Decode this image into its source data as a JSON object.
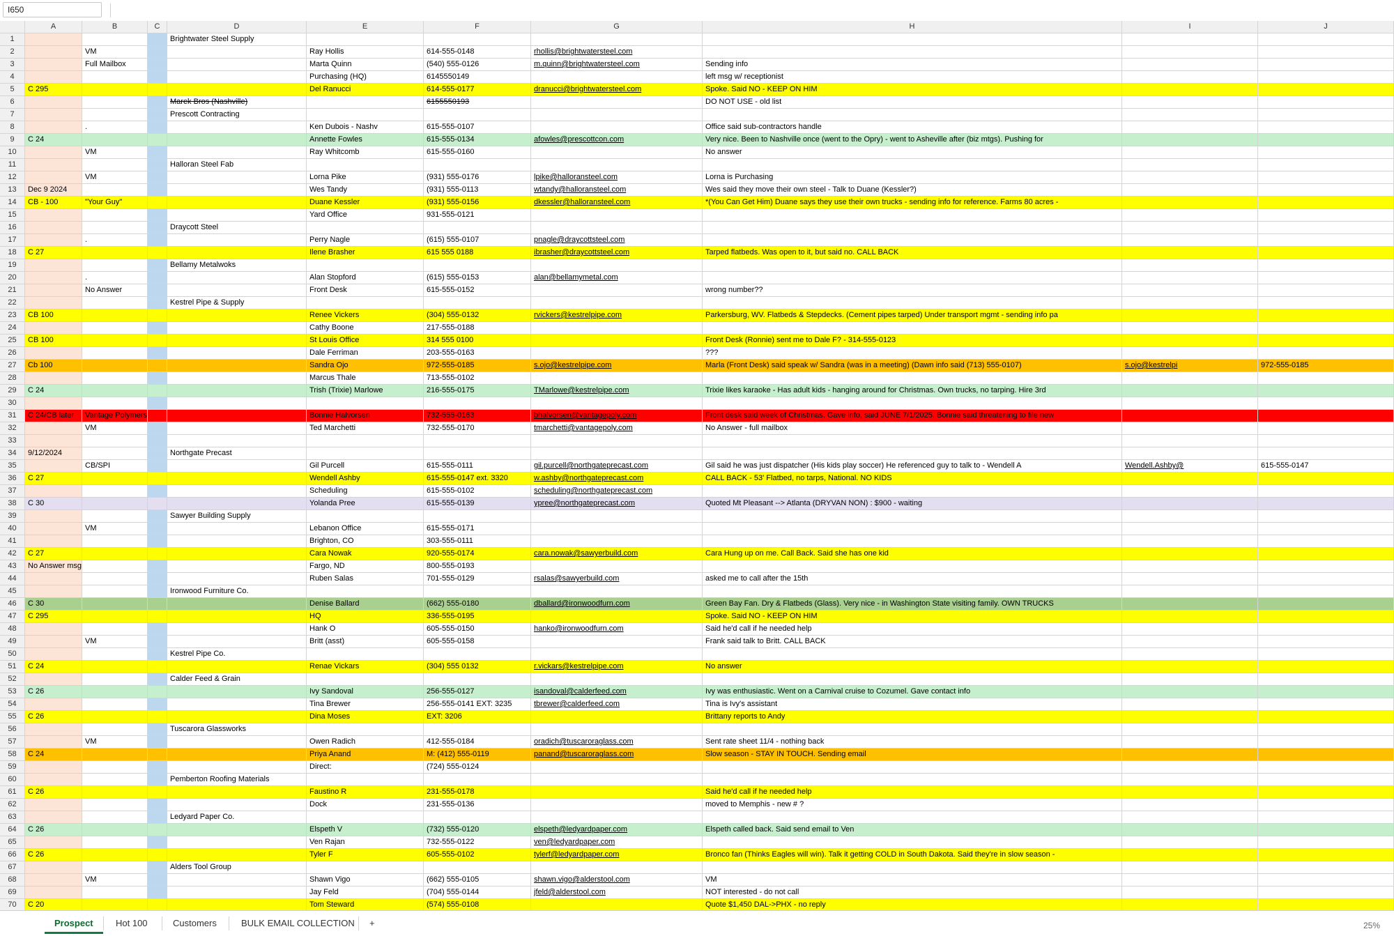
{
  "name_box": "I650",
  "columns": [
    "A",
    "B",
    "C",
    "D",
    "E",
    "F",
    "G",
    "H",
    "I",
    "J"
  ],
  "colors": {
    "yellow": "#ffff00",
    "green": "#c6efce",
    "orange": "#ffc000",
    "red": "#ff0000",
    "lavender": "#e4dff0",
    "darkgreen": "#a9d08e",
    "colA": "#fce4d6",
    "colC": "#bdd7ee"
  },
  "rows": [
    {
      "n": "1",
      "c": "",
      "a": "",
      "b": "",
      "d": "Brightwater Steel Supply",
      "e": "",
      "f": "",
      "g": "",
      "h": "",
      "i": "",
      "j": ""
    },
    {
      "n": "2",
      "c": "",
      "a": "",
      "b": "VM",
      "d": "",
      "e": "Ray Hollis",
      "f": "614-555-0148",
      "g": "rhollis@brightwatersteel.com",
      "h": "",
      "i": "",
      "j": ""
    },
    {
      "n": "3",
      "c": "",
      "a": "",
      "b": "Full Mailbox",
      "d": "",
      "e": "Marta Quinn",
      "f": "(540) 555-0126",
      "g": "m.quinn@brightwatersteel.com",
      "h": "Sending info",
      "i": "",
      "j": ""
    },
    {
      "n": "4",
      "c": "",
      "a": "",
      "b": "",
      "d": "",
      "e": "Purchasing (HQ)",
      "f": "6145550149",
      "g": "",
      "h": "left msg w/ receptionist",
      "i": "",
      "j": ""
    },
    {
      "n": "5",
      "c": "yellow",
      "a": "C 295",
      "b": "",
      "d": "",
      "e": "Del Ranucci",
      "f": "614-555-0177",
      "g": "dranucci@brightwatersteel.com",
      "h": "Spoke. Said NO - KEEP ON HIM",
      "i": "",
      "j": ""
    },
    {
      "n": "6",
      "c": "",
      "a": "",
      "b": "",
      "d": "Marek Bros (Nashville)",
      "e": "",
      "f": "6155550193",
      "g": "",
      "h": "DO NOT USE - old list",
      "i": "",
      "j": "",
      "strike": true
    },
    {
      "n": "7",
      "c": "",
      "a": "",
      "b": "",
      "d": "Prescott Contracting",
      "e": "",
      "f": "",
      "g": "",
      "h": "",
      "i": "",
      "j": ""
    },
    {
      "n": "8",
      "c": "",
      "a": "",
      "b": ".",
      "d": "",
      "e": "Ken Dubois - Nashv",
      "f": "615-555-0107",
      "g": "",
      "h": "Office said sub-contractors handle",
      "i": "",
      "j": ""
    },
    {
      "n": "9",
      "c": "green",
      "a": "C 24",
      "b": "",
      "d": "",
      "e": "Annette Fowles",
      "f": "615-555-0134",
      "g": "afowles@prescottcon.com",
      "h": "Very nice. Been to Nashville once (went to the Opry) - went to Asheville after (biz mtgs). Pushing for",
      "i": "",
      "j": ""
    },
    {
      "n": "10",
      "c": "",
      "a": "",
      "b": "VM",
      "d": "",
      "e": "Ray Whitcomb",
      "f": "615-555-0160",
      "g": "",
      "h": "No answer",
      "i": "",
      "j": ""
    },
    {
      "n": "11",
      "c": "",
      "a": "",
      "b": "",
      "d": "Halloran Steel Fab",
      "e": "",
      "f": "",
      "g": "",
      "h": "",
      "i": "",
      "j": ""
    },
    {
      "n": "12",
      "c": "",
      "a": "",
      "b": "VM",
      "d": "",
      "e": "Lorna Pike",
      "f": "(931) 555-0176",
      "g": "lpike@halloransteel.com",
      "h": "Lorna is Purchasing",
      "i": "",
      "j": ""
    },
    {
      "n": "13",
      "c": "",
      "a": "Dec 9 2024",
      "b": "",
      "d": "",
      "e": "Wes Tandy",
      "f": "(931) 555-0113",
      "g": "wtandy@halloransteel.com",
      "h": "Wes said they move their own steel - Talk to Duane (Kessler?)",
      "i": "",
      "j": ""
    },
    {
      "n": "14",
      "c": "yellow",
      "a": "CB - 100",
      "b": "\"Your Guy\"",
      "d": "",
      "e": "Duane Kessler",
      "f": "(931) 555-0156",
      "g": "dkessler@halloransteel.com",
      "h": "*(You Can Get Him) Duane says they use their own trucks - sending info for reference. Farms 80 acres -",
      "i": "",
      "j": ""
    },
    {
      "n": "15",
      "c": "",
      "a": "",
      "b": "",
      "d": "",
      "e": "Yard Office",
      "f": "931-555-0121",
      "g": "",
      "h": "",
      "i": "",
      "j": ""
    },
    {
      "n": "16",
      "c": "",
      "a": "",
      "b": "",
      "d": "Draycott Steel",
      "e": "",
      "f": "",
      "g": "",
      "h": "",
      "i": "",
      "j": ""
    },
    {
      "n": "17",
      "c": "",
      "a": "",
      "b": ".",
      "d": "",
      "e": "Perry Nagle",
      "f": "(615) 555-0107",
      "g": "pnagle@draycottsteel.com",
      "h": "",
      "i": "",
      "j": ""
    },
    {
      "n": "18",
      "c": "yellow",
      "a": "C 27",
      "b": "",
      "d": "",
      "e": "Ilene Brasher",
      "f": "615 555 0188",
      "g": "ibrasher@draycottsteel.com",
      "h": "Tarped flatbeds. Was open to it, but said no. CALL BACK",
      "i": "",
      "j": ""
    },
    {
      "n": "19",
      "c": "",
      "a": "",
      "b": "",
      "d": "Bellamy Metalwoks",
      "e": "",
      "f": "",
      "g": "",
      "h": "",
      "i": "",
      "j": ""
    },
    {
      "n": "20",
      "c": "",
      "a": "",
      "b": ".",
      "d": "",
      "e": "Alan Stopford",
      "f": "(615) 555-0153",
      "g": "alan@bellamymetal.com",
      "h": "",
      "i": "",
      "j": ""
    },
    {
      "n": "21",
      "c": "",
      "a": "",
      "b": "No Answer",
      "d": "",
      "e": "Front Desk",
      "f": "615-555-0152",
      "g": "",
      "h": "wrong number??",
      "i": "",
      "j": ""
    },
    {
      "n": "22",
      "c": "",
      "a": "",
      "b": "",
      "d": "Kestrel Pipe & Supply",
      "e": "",
      "f": "",
      "g": "",
      "h": "",
      "i": "",
      "j": ""
    },
    {
      "n": "23",
      "c": "yellow",
      "a": "CB 100",
      "b": "",
      "d": "",
      "e": "Renee Vickers",
      "f": "(304) 555-0132",
      "g": "rvickers@kestrelpipe.com",
      "h": "Parkersburg, WV. Flatbeds & Stepdecks. (Cement pipes tarped) Under transport mgmt - sending info pa",
      "i": "",
      "j": ""
    },
    {
      "n": "24",
      "c": "",
      "a": "",
      "b": "",
      "d": "",
      "e": "Cathy Boone",
      "f": "217-555-0188",
      "g": "",
      "h": "",
      "i": "",
      "j": ""
    },
    {
      "n": "25",
      "c": "yellow",
      "a": "CB 100",
      "b": "",
      "d": "",
      "e": "St Louis Office",
      "f": "314 555 0100",
      "g": "",
      "h": "Front Desk (Ronnie) sent me to Dale F? - 314-555-0123",
      "i": "",
      "j": ""
    },
    {
      "n": "26",
      "c": "",
      "a": "",
      "b": "",
      "d": "",
      "e": "Dale Ferriman",
      "f": "203-555-0163",
      "g": "",
      "h": "???",
      "i": "",
      "j": ""
    },
    {
      "n": "27",
      "c": "orange",
      "a": "Cb 100",
      "b": "",
      "d": "",
      "e": "Sandra Ojo",
      "f": "972-555-0185",
      "g": "s.ojo@kestrelpipe.com",
      "h": "Marla (Front Desk) said speak w/ Sandra (was in a meeting) (Dawn info said (713) 555-0107)",
      "i": "s.ojo@kestrelpi",
      "j": "972-555-0185"
    },
    {
      "n": "28",
      "c": "",
      "a": "",
      "b": "",
      "d": "",
      "e": "Marcus Thale",
      "f": "713-555-0102",
      "g": "",
      "h": "",
      "i": "",
      "j": ""
    },
    {
      "n": "29",
      "c": "green",
      "a": "C 24",
      "b": "",
      "d": "",
      "e": "Trish (Trixie) Marlowe",
      "f": "216-555-0175",
      "g": "TMarlowe@kestrelpipe.com",
      "h": "Trixie likes karaoke - Has adult kids - hanging around for Christmas. Own trucks, no tarping. Hire 3rd",
      "i": "",
      "j": ""
    },
    {
      "n": "30",
      "c": "",
      "a": "",
      "b": "",
      "d": "",
      "e": "",
      "f": "",
      "g": "",
      "h": "",
      "i": "",
      "j": ""
    },
    {
      "n": "31",
      "c": "red",
      "a": "C 24/CB later",
      "b": "Vantage Polymers",
      "d": "",
      "e": "Bonnie Halvorsen",
      "f": "732-555-0163",
      "g": "bhalvorsen@vantagepoly.com",
      "h": "Front desk said week of Christmas. Gave info, said JUNE 7/1/2025. Bonnie said threatening to file new",
      "i": "",
      "j": ""
    },
    {
      "n": "32",
      "c": "",
      "a": "",
      "b": "VM",
      "d": "",
      "e": "Ted Marchetti",
      "f": "732-555-0170",
      "g": "tmarchetti@vantagepoly.com",
      "h": "No Answer - full mailbox",
      "i": "",
      "j": ""
    },
    {
      "n": "33",
      "c": "",
      "a": "",
      "b": "",
      "d": "",
      "e": "",
      "f": "",
      "g": "",
      "h": "",
      "i": "",
      "j": ""
    },
    {
      "n": "34",
      "c": "",
      "a": "9/12/2024",
      "b": "",
      "d": "Northgate Precast",
      "e": "",
      "f": "",
      "g": "",
      "h": "",
      "i": "",
      "j": ""
    },
    {
      "n": "35",
      "c": "",
      "a": "",
      "b": "CB/SPI",
      "d": "",
      "e": "Gil Purcell",
      "f": "615-555-0111",
      "g": "gil.purcell@northgateprecast.com",
      "h": "Gil said he was just dispatcher (His kids play soccer) He referenced guy to talk to - Wendell A",
      "i": "Wendell.Ashby@",
      "j": "615-555-0147"
    },
    {
      "n": "36",
      "c": "yellow",
      "a": "C 27",
      "b": "",
      "d": "",
      "e": "Wendell Ashby",
      "f": "615-555-0147 ext. 3320",
      "g": "w.ashby@northgateprecast.com",
      "h": "CALL BACK - 53' Flatbed, no tarps, National. NO KIDS",
      "i": "",
      "j": ""
    },
    {
      "n": "37",
      "c": "",
      "a": "",
      "b": "",
      "d": "",
      "e": "Scheduling",
      "f": "615-555-0102",
      "g": "scheduling@northgateprecast.com",
      "h": "",
      "i": "",
      "j": ""
    },
    {
      "n": "38",
      "c": "lavender",
      "a": "C 30",
      "b": "",
      "d": "",
      "e": "Yolanda Pree",
      "f": "615-555-0139",
      "g": "ypree@northgateprecast.com",
      "h": "Quoted Mt Pleasant --> Atlanta (DRYVAN NON) : $900 - waiting",
      "i": "",
      "j": ""
    },
    {
      "n": "39",
      "c": "",
      "a": "",
      "b": "",
      "d": "Sawyer Building Supply",
      "e": "",
      "f": "",
      "g": "",
      "h": "",
      "i": "",
      "j": ""
    },
    {
      "n": "40",
      "c": "",
      "a": "",
      "b": "VM",
      "d": "",
      "e": "Lebanon Office",
      "f": "615-555-0171",
      "g": "",
      "h": "",
      "i": "",
      "j": ""
    },
    {
      "n": "41",
      "c": "",
      "a": "",
      "b": "",
      "d": "",
      "e": "Brighton, CO",
      "f": "303-555-0111",
      "g": "",
      "h": "",
      "i": "",
      "j": ""
    },
    {
      "n": "42",
      "c": "yellow",
      "a": "C 27",
      "b": "",
      "d": "",
      "e": "Cara Nowak",
      "f": "920-555-0174",
      "g": "cara.nowak@sawyerbuild.com",
      "h": "Cara Hung up on me. Call Back. Said she has one kid",
      "i": "",
      "j": ""
    },
    {
      "n": "43",
      "c": "",
      "a": "No Answer msg",
      "b": "",
      "d": "",
      "e": "Fargo, ND",
      "f": "800-555-0193",
      "g": "",
      "h": "",
      "i": "",
      "j": ""
    },
    {
      "n": "44",
      "c": "",
      "a": "",
      "b": "",
      "d": "",
      "e": "Ruben Salas",
      "f": "701-555-0129",
      "g": "rsalas@sawyerbuild.com",
      "h": "asked me to call after the 15th",
      "i": "",
      "j": ""
    },
    {
      "n": "45",
      "c": "",
      "a": "",
      "b": "",
      "d": "Ironwood Furniture Co.",
      "e": "",
      "f": "",
      "g": "",
      "h": "",
      "i": "",
      "j": ""
    },
    {
      "n": "46",
      "c": "darkgreen",
      "a": "C 30",
      "b": "",
      "d": "",
      "e": "Denise Ballard",
      "f": "(662) 555-0180",
      "g": "dballard@ironwoodfurn.com",
      "h": "Green Bay Fan. Dry & Flatbeds (Glass). Very nice - in Washington State visiting family. OWN TRUCKS",
      "i": "",
      "j": ""
    },
    {
      "n": "47",
      "c": "yellow",
      "a": "C 295",
      "b": "",
      "d": "",
      "e": "HQ",
      "f": "336-555-0195",
      "g": "",
      "h": "Spoke. Said NO - KEEP ON HIM",
      "i": "",
      "j": ""
    },
    {
      "n": "48",
      "c": "",
      "a": "",
      "b": "",
      "d": "",
      "e": "Hank O",
      "f": "605-555-0150",
      "g": "hanko@ironwoodfurn.com",
      "h": "Said he'd call if he needed help",
      "i": "",
      "j": ""
    },
    {
      "n": "49",
      "c": "",
      "a": "",
      "b": "VM",
      "d": "",
      "e": "Britt (asst)",
      "f": "605-555-0158",
      "g": "",
      "h": "Frank said talk to Britt. CALL BACK",
      "i": "",
      "j": ""
    },
    {
      "n": "50",
      "c": "",
      "a": "",
      "b": "",
      "d": "Kestrel Pipe Co.",
      "e": "",
      "f": "",
      "g": "",
      "h": "",
      "i": "",
      "j": ""
    },
    {
      "n": "51",
      "c": "yellow",
      "a": "C 24",
      "b": "",
      "d": "",
      "e": "Renae Vickars",
      "f": "(304) 555 0132",
      "g": "r.vickars@kestrelpipe.com",
      "h": "No answer",
      "i": "",
      "j": ""
    },
    {
      "n": "52",
      "c": "",
      "a": "",
      "b": "",
      "d": "Calder Feed & Grain",
      "e": "",
      "f": "",
      "g": "",
      "h": "",
      "i": "",
      "j": ""
    },
    {
      "n": "53",
      "c": "green",
      "a": "C 26",
      "b": "",
      "d": "",
      "e": "Ivy Sandoval",
      "f": "256-555-0127",
      "g": "isandoval@calderfeed.com",
      "h": "Ivy was enthusiastic. Went on a Carnival cruise to Cozumel. Gave contact info",
      "i": "",
      "j": ""
    },
    {
      "n": "54",
      "c": "",
      "a": "",
      "b": "",
      "d": "",
      "e": "Tina Brewer",
      "f": "256-555-0141 EXT: 3235",
      "g": "tbrewer@calderfeed.com",
      "h": "Tina is Ivy's assistant",
      "i": "",
      "j": ""
    },
    {
      "n": "55",
      "c": "yellow",
      "a": "C 26",
      "b": "",
      "d": "",
      "e": "Dina Moses",
      "f": "EXT: 3206",
      "g": "",
      "h": "Brittany reports to Andy",
      "i": "",
      "j": ""
    },
    {
      "n": "56",
      "c": "",
      "a": "",
      "b": "",
      "d": "Tuscarora Glassworks",
      "e": "",
      "f": "",
      "g": "",
      "h": "",
      "i": "",
      "j": ""
    },
    {
      "n": "57",
      "c": "",
      "a": "",
      "b": "VM",
      "d": "",
      "e": "Owen Radich",
      "f": "412-555-0184",
      "g": "oradich@tuscaroraglass.com",
      "h": "Sent rate sheet 11/4 - nothing back",
      "i": "",
      "j": ""
    },
    {
      "n": "58",
      "c": "orange",
      "a": "C 24",
      "b": "",
      "d": "",
      "e": "Priya Anand",
      "f": "M: (412) 555-0119",
      "g": "panand@tuscaroraglass.com",
      "h": "Slow season - STAY IN TOUCH. Sending email",
      "i": "",
      "j": ""
    },
    {
      "n": "59",
      "c": "",
      "a": "",
      "b": "",
      "d": "",
      "e": "Direct:",
      "f": "(724) 555-0124",
      "g": "",
      "h": "",
      "i": "",
      "j": ""
    },
    {
      "n": "60",
      "c": "",
      "a": "",
      "b": "",
      "d": "Pemberton Roofing Materials",
      "e": "",
      "f": "",
      "g": "",
      "h": "",
      "i": "",
      "j": ""
    },
    {
      "n": "61",
      "c": "yellow",
      "a": "C 26",
      "b": "",
      "d": "",
      "e": "Faustino R",
      "f": "231-555-0178",
      "g": "",
      "h": "Said he'd call if he needed help",
      "i": "",
      "j": ""
    },
    {
      "n": "62",
      "c": "",
      "a": "",
      "b": "",
      "d": "",
      "e": "Dock",
      "f": "231-555-0136",
      "g": "",
      "h": "moved to Memphis - new # ?",
      "i": "",
      "j": ""
    },
    {
      "n": "63",
      "c": "",
      "a": "",
      "b": "",
      "d": "Ledyard Paper Co.",
      "e": "",
      "f": "",
      "g": "",
      "h": "",
      "i": "",
      "j": ""
    },
    {
      "n": "64",
      "c": "green",
      "a": "C 26",
      "b": "",
      "d": "",
      "e": "Elspeth V",
      "f": "(732) 555-0120",
      "g": "elspeth@ledyardpaper.com",
      "h": "Elspeth called back. Said send email to Ven",
      "i": "",
      "j": ""
    },
    {
      "n": "65",
      "c": "",
      "a": "",
      "b": "",
      "d": "",
      "e": "Ven Rajan",
      "f": "732-555-0122",
      "g": "ven@ledyardpaper.com",
      "h": "",
      "i": "",
      "j": ""
    },
    {
      "n": "66",
      "c": "yellow",
      "a": "C 26",
      "b": "",
      "d": "",
      "e": "Tyler F",
      "f": "605-555-0102",
      "g": "tylerf@ledyardpaper.com",
      "h": "Bronco fan (Thinks Eagles will win). Talk it getting COLD in South Dakota. Said they're in slow season -",
      "i": "",
      "j": ""
    },
    {
      "n": "67",
      "c": "",
      "a": "",
      "b": "",
      "d": "Alders Tool Group",
      "e": "",
      "f": "",
      "g": "",
      "h": "",
      "i": "",
      "j": ""
    },
    {
      "n": "68",
      "c": "",
      "a": "",
      "b": "VM",
      "d": "",
      "e": "Shawn Vigo",
      "f": "(662) 555-0105",
      "g": "shawn.vigo@alderstool.com",
      "h": "VM",
      "i": "",
      "j": ""
    },
    {
      "n": "69",
      "c": "",
      "a": "",
      "b": "",
      "d": "",
      "e": "Jay Feld",
      "f": "(704) 555-0144",
      "g": "jfeld@alderstool.com",
      "h": "NOT interested - do not call",
      "i": "",
      "j": ""
    },
    {
      "n": "70",
      "c": "yellow",
      "a": "C 20",
      "b": "",
      "d": "",
      "e": "Tom Steward",
      "f": "(574) 555-0108",
      "g": "",
      "h": "Quote $1,450 DAL->PHX - no reply",
      "i": "",
      "j": ""
    }
  ],
  "sheet_tabs": [
    "Prospect",
    "Hot 100",
    "Customers",
    "BULK EMAIL COLLECTION"
  ],
  "add_sheet": "+",
  "zoom": "25%"
}
